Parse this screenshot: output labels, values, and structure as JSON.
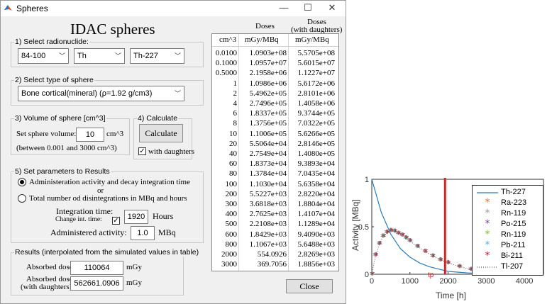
{
  "window": {
    "title": "Spheres",
    "heading": "IDAC spheres",
    "minimize_glyph": "—",
    "maximize_glyph": "☐",
    "close_glyph": "✕"
  },
  "radionuclide": {
    "legend": "1) Select radionuclide:",
    "range_value": "84-100",
    "element_value": "Th",
    "nuclide_value": "Th-227"
  },
  "sphere_type": {
    "legend": "2) Select type of sphere",
    "value": "Bone cortical(mineral) (ρ=1.92 g/cm3)"
  },
  "volume": {
    "legend": "3) Volume of sphere [cm^3]",
    "label": "Set sphere volume:",
    "value": "10",
    "unit": "cm^3",
    "range_note": "(between 0.001 and 3000 cm^3)"
  },
  "calculate": {
    "legend": "4) Calculate",
    "button_label": "Calculate",
    "with_daughters_label": "with daughters",
    "with_daughters_checked": true
  },
  "params": {
    "legend": "5) Set parameters to Results",
    "option1_label": "Administeration activity and decay integration time",
    "or_label": "or",
    "option2_label": "Total number od disintegrations in MBq and hours",
    "selected_option": 1,
    "integration_label": "Integration time:",
    "change_int_label": "Change int. time:",
    "change_int_checked": true,
    "integration_value": "1920",
    "integration_unit": "Hours",
    "activity_label": "Administered activity:",
    "activity_value": "1.0",
    "activity_unit": "MBq"
  },
  "results": {
    "legend": "Results (interpolated from the simulated values in table)",
    "absorbed_label": "Absorbed dose:",
    "absorbed_value": "110064",
    "absorbed_unit": "mGy",
    "absorbed_d_label1": "Absorbed dose:",
    "absorbed_d_label2": "(with daughters)",
    "absorbed_d_value": "562661.0906",
    "absorbed_d_unit": "mGy"
  },
  "close_button": "Close",
  "table": {
    "top_header_doses": "Doses",
    "top_header_daughters1": "Doses",
    "top_header_daughters2": "(with daughters)",
    "columns": [
      "cm^3",
      "mGy/MBq",
      "mGy/MBq"
    ],
    "rows": [
      [
        "0.0100",
        "1.0903e+08",
        "5.5705e+08"
      ],
      [
        "0.1000",
        "1.0957e+07",
        "5.6015e+07"
      ],
      [
        "0.5000",
        "2.1958e+06",
        "1.1227e+07"
      ],
      [
        "1",
        "1.0986e+06",
        "5.6172e+06"
      ],
      [
        "2",
        "5.4962e+05",
        "2.8101e+06"
      ],
      [
        "4",
        "2.7496e+05",
        "1.4058e+06"
      ],
      [
        "6",
        "1.8337e+05",
        "9.3744e+05"
      ],
      [
        "8",
        "1.3756e+05",
        "7.0322e+05"
      ],
      [
        "10",
        "1.1006e+05",
        "5.6266e+05"
      ],
      [
        "20",
        "5.5064e+04",
        "2.8146e+05"
      ],
      [
        "40",
        "2.7549e+04",
        "1.4080e+05"
      ],
      [
        "60",
        "1.8373e+04",
        "9.3893e+04"
      ],
      [
        "80",
        "1.3784e+04",
        "7.0435e+04"
      ],
      [
        "100",
        "1.1030e+04",
        "5.6358e+04"
      ],
      [
        "200",
        "5.5227e+03",
        "2.8220e+04"
      ],
      [
        "300",
        "3.6818e+03",
        "1.8804e+04"
      ],
      [
        "400",
        "2.7625e+03",
        "1.4107e+04"
      ],
      [
        "500",
        "2.2108e+03",
        "1.1289e+04"
      ],
      [
        "600",
        "1.8429e+03",
        "9.4090e+03"
      ],
      [
        "800",
        "1.1067e+03",
        "5.6488e+03"
      ],
      [
        "2000",
        "554.0926",
        "2.8269e+03"
      ],
      [
        "3000",
        "369.7056",
        "1.8856e+03"
      ]
    ]
  },
  "chart_data": {
    "type": "line",
    "xlabel": "Time [h]",
    "ylabel": "Activity [MBq]",
    "xlim": [
      0,
      4500
    ],
    "ylim": [
      0,
      1
    ],
    "xticks": [
      "0",
      "1000",
      "2000",
      "3000",
      "4000"
    ],
    "yticks": [
      "0",
      "0.5",
      "1"
    ],
    "marker_label": "tp",
    "vertical_line_x": 1920,
    "legend_position": "top-right",
    "series": [
      {
        "name": "Th-227",
        "style": "line",
        "color": "#2b7bba"
      },
      {
        "name": "Ra-223",
        "style": "star",
        "color": "#e36b3c"
      },
      {
        "name": "Rn-119",
        "style": "star",
        "color": "#9a9a9a"
      },
      {
        "name": "Po-215",
        "style": "star",
        "color": "#8a3aa8"
      },
      {
        "name": "Rn-119",
        "style": "star",
        "color": "#7bbd3a"
      },
      {
        "name": "Pb-211",
        "style": "star",
        "color": "#4fb7e8"
      },
      {
        "name": "Bi-211",
        "style": "star",
        "color": "#a3232e"
      },
      {
        "name": "Tl-207",
        "style": "dotted",
        "color": "#333333"
      }
    ],
    "parent_curve": {
      "x": [
        0,
        250,
        500,
        750,
        1000,
        1250,
        1500,
        2000,
        2500,
        3000,
        3500,
        4000,
        4400
      ],
      "y": [
        1.0,
        0.65,
        0.42,
        0.27,
        0.18,
        0.12,
        0.08,
        0.03,
        0.014,
        0.006,
        0.003,
        0.001,
        0.0
      ]
    },
    "daughter_curve": {
      "x": [
        0,
        100,
        200,
        300,
        400,
        500,
        600,
        700,
        800,
        900,
        1000,
        1200,
        1400,
        1600,
        1800,
        2000,
        2300,
        2600,
        2900,
        3200,
        3600,
        4000,
        4300
      ],
      "y": [
        0.0,
        0.2,
        0.32,
        0.4,
        0.44,
        0.46,
        0.45,
        0.43,
        0.41,
        0.38,
        0.35,
        0.29,
        0.24,
        0.19,
        0.15,
        0.12,
        0.08,
        0.05,
        0.03,
        0.02,
        0.01,
        0.005,
        0.0
      ]
    }
  }
}
